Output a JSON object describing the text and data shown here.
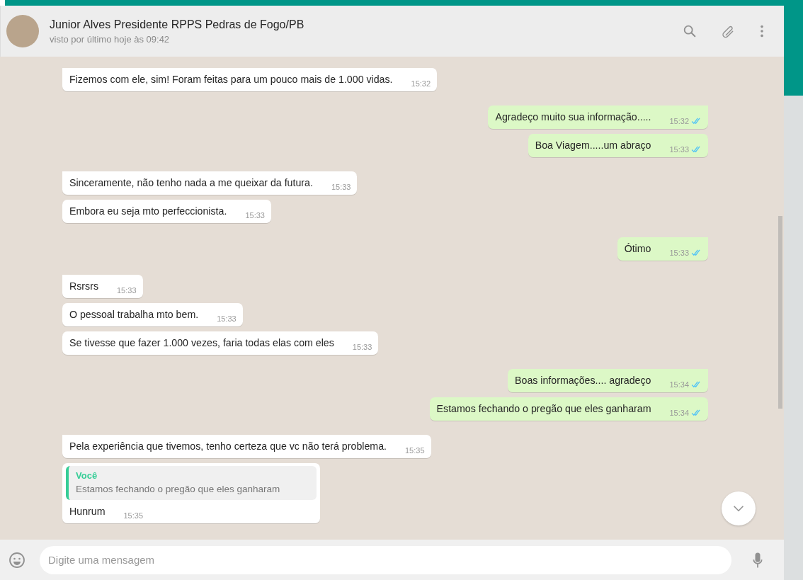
{
  "header": {
    "contact_name": "Junior Alves Presidente RPPS Pedras de Fogo/PB",
    "status": "visto por último hoje às 09:42"
  },
  "groups": [
    {
      "kind": "in",
      "messages": [
        {
          "text": "Fizemos com ele, sim! Foram feitas para um pouco mais de 1.000 vidas.",
          "time": "15:32"
        }
      ]
    },
    {
      "kind": "out",
      "messages": [
        {
          "text": "Agradeço muito sua informação.....",
          "time": "15:32",
          "read": true
        },
        {
          "text": "Boa Viagem.....um abraço",
          "time": "15:33",
          "read": true
        }
      ]
    },
    {
      "kind": "in",
      "messages": [
        {
          "text": "Sinceramente, não tenho nada a me queixar da futura.",
          "time": "15:33"
        },
        {
          "text": "Embora eu seja mto perfeccionista.",
          "time": "15:33"
        }
      ]
    },
    {
      "kind": "out",
      "messages": [
        {
          "text": "Ótimo",
          "time": "15:33",
          "read": true
        }
      ]
    },
    {
      "kind": "in",
      "messages": [
        {
          "text": "Rsrsrs",
          "time": "15:33"
        },
        {
          "text": "O pessoal trabalha mto bem.",
          "time": "15:33"
        },
        {
          "text": "Se tivesse que fazer 1.000 vezes, faria todas elas com eles",
          "time": "15:33"
        }
      ]
    },
    {
      "kind": "out",
      "messages": [
        {
          "text": "Boas informações.... agradeço",
          "time": "15:34",
          "read": true
        },
        {
          "text": "Estamos fechando o pregão que eles ganharam",
          "time": "15:34",
          "read": true
        }
      ]
    },
    {
      "kind": "in",
      "messages": [
        {
          "text": "Pela experiência que tivemos, tenho certeza que vc não terá problema.",
          "time": "15:35"
        },
        {
          "text": "Hunrum",
          "time": "15:35",
          "reply": {
            "author": "Você",
            "text": "Estamos fechando o pregão que eles ganharam"
          }
        }
      ]
    }
  ],
  "composer": {
    "placeholder": "Digite uma mensagem"
  }
}
